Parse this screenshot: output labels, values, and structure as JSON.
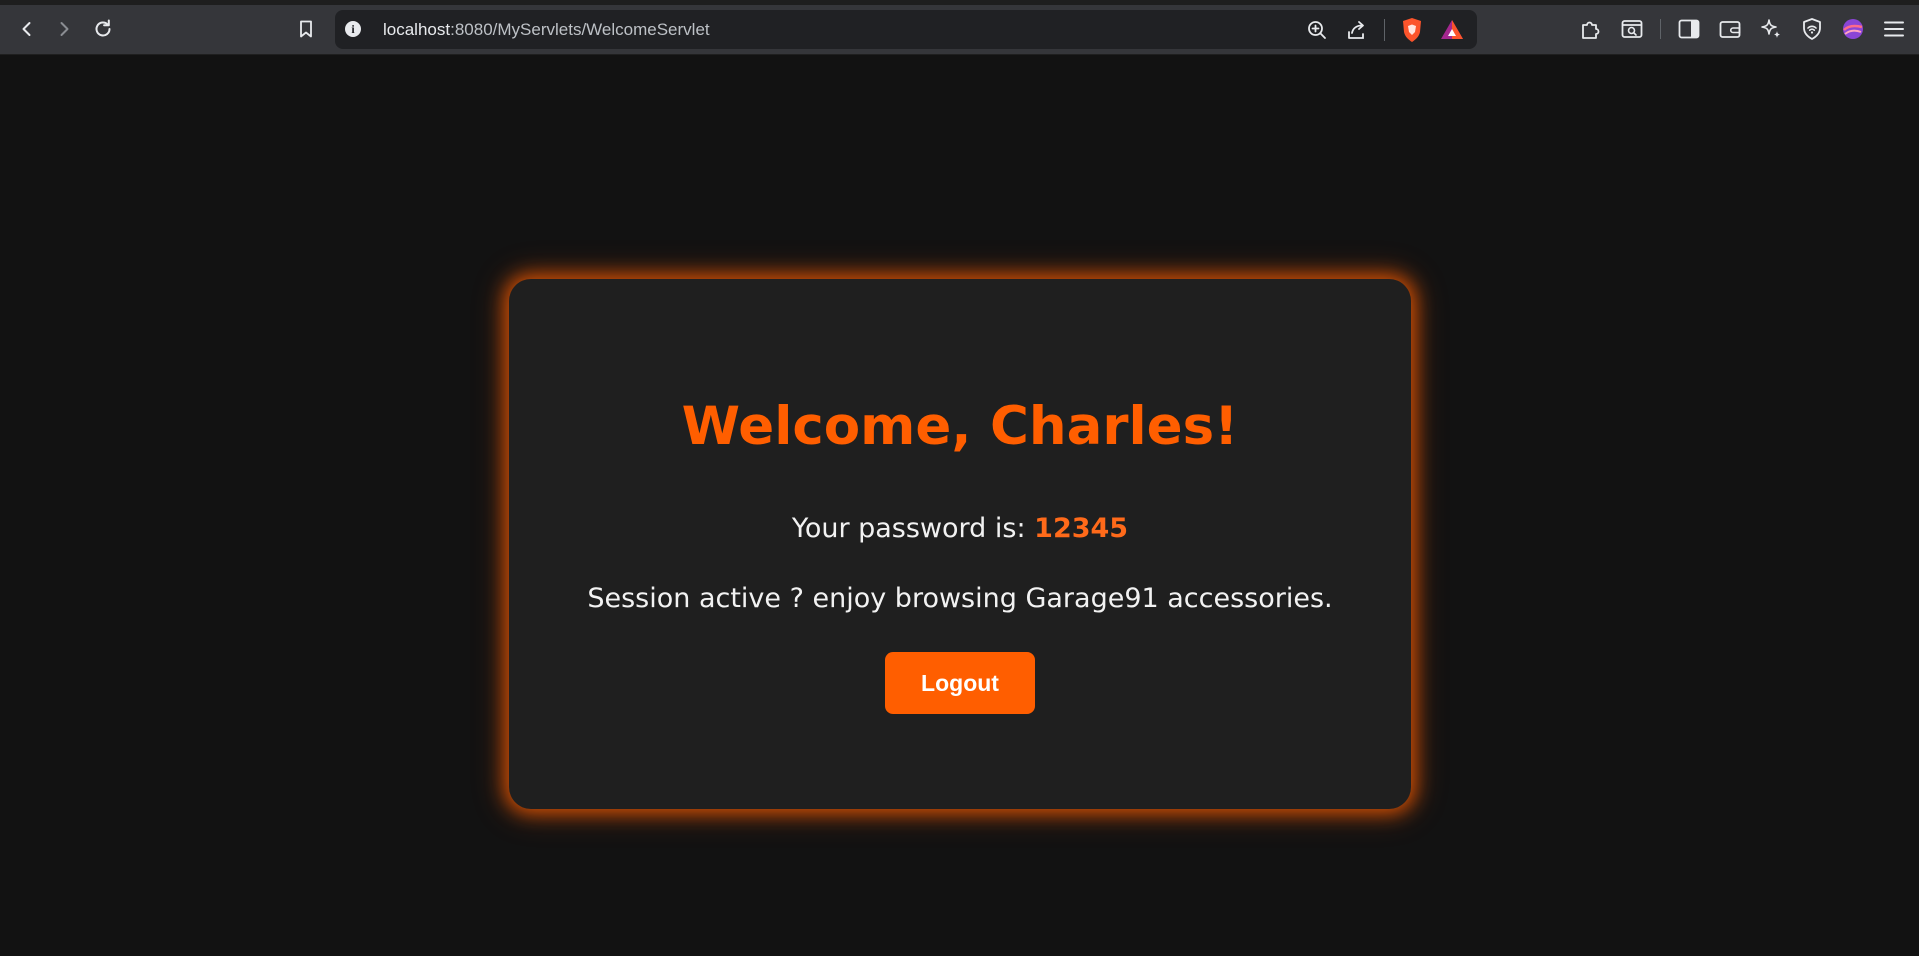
{
  "browser": {
    "url_host": "localhost",
    "url_rest": ":8080/MyServlets/WelcomeServlet",
    "icons": [
      "back-icon",
      "forward-icon",
      "reload-icon",
      "bookmark-icon",
      "info-icon",
      "zoom-icon",
      "share-icon",
      "brave-shields-icon",
      "brave-rewards-icon",
      "extensions-icon",
      "tab-search-icon",
      "sidebar-icon",
      "wallet-icon",
      "leo-ai-icon",
      "vpn-icon",
      "profile-icon",
      "menu-icon"
    ]
  },
  "page": {
    "welcome": "Welcome, Charles!",
    "password_label": "Your password is: ",
    "password_value": "12345",
    "session_text": "Session active ? enjoy browsing Garage91 accessories.",
    "logout_label": "Logout"
  },
  "colors": {
    "accent": "#ff5e00",
    "background": "#121212",
    "card": "#1f1f1f",
    "text": "#f2f2f2"
  }
}
